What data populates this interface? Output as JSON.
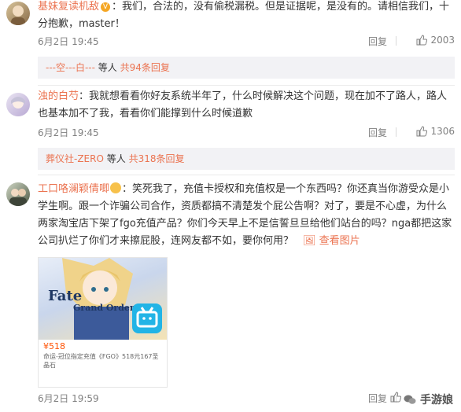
{
  "comments": [
    {
      "username": "基妹复读机敌",
      "text": "我们，合法的，没有偷税漏税。但是证据呢，是没有的。请相信我们，十分抱歉，master！",
      "time": "6月2日 19:45",
      "reply_label": "回复",
      "likes": "2003",
      "thread": {
        "first_user": "---空---白---",
        "middle": " 等人 ",
        "count": "共94条回复"
      }
    },
    {
      "username": "浊的白芍",
      "text": "我就想看看你好友系统半年了，什么时候解决这个问题，现在加不了路人，路人也基本加不了我，看看你们能撑到什么时候道歉",
      "time": "6月2日 19:45",
      "reply_label": "回复",
      "likes": "1306",
      "thread": {
        "first_user": "葬仪社-ZERO",
        "middle": " 等人 ",
        "count": "共318条回复"
      }
    },
    {
      "username": "工口咯澜颖倩唧",
      "text": "：笑死我了，充值卡授权和充值权是一个东西吗？你还真当你游受众是小学生啊。跟一个诈骗公司合作，资质都搞不清楚发个屁公告啊？对了，要是不心虚，为什么两家淘宝店下架了fgo充值产品？你们今天早上不是信誓旦旦给他们站台的吗？nga都把这家公司扒烂了你们才来擦屁股，连网友都不如，要你何用？",
      "view_image": "查看图片",
      "time": "6月2日 19:59",
      "reply_label": "回复",
      "likes": "",
      "card": {
        "logo_line1": "Fate",
        "logo_line2": "Grand Order",
        "price": "¥518",
        "desc": "命运-冠位指定充值《FGO》518元167圣晶石"
      }
    }
  ],
  "watermark": "手游娘",
  "colors": {
    "accent": "#eb7350",
    "meta": "#808080",
    "thread_bg": "#f2f2f5"
  }
}
